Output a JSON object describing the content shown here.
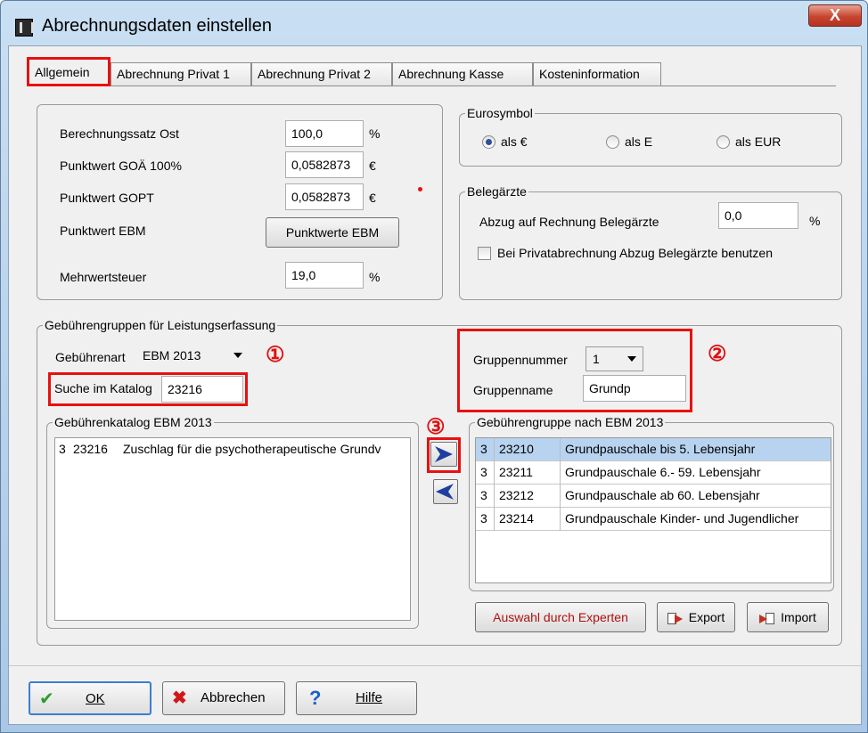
{
  "window": {
    "title": "Abrechnungsdaten einstellen",
    "close_label": "X"
  },
  "tabs": [
    "Allgemein",
    "Abrechnung Privat 1",
    "Abrechnung Privat 2",
    "Abrechnung Kasse",
    "Kosteninformation"
  ],
  "left_panel": {
    "berechnungssatz_label": "Berechnungssatz Ost",
    "berechnungssatz_value": "100,0",
    "berechnungssatz_unit": "%",
    "punktwert_goae_label": "Punktwert GOÄ 100%",
    "punktwert_goae_value": "0,0582873",
    "punktwert_goae_unit": "€",
    "punktwert_gopt_label": "Punktwert GOPT",
    "punktwert_gopt_value": "0,0582873",
    "punktwert_gopt_unit": "€",
    "punktwert_ebm_label": "Punktwert EBM",
    "punktwerte_ebm_button": "Punktwerte EBM",
    "mwst_label": "Mehrwertsteuer",
    "mwst_value": "19,0",
    "mwst_unit": "%"
  },
  "eurosymbol": {
    "legend": "Eurosymbol",
    "options": [
      "als €",
      "als E",
      "als EUR"
    ],
    "selected": "als €"
  },
  "belegaerzte": {
    "legend": "Belegärzte",
    "abzug_label": "Abzug auf Rechnung Belegärzte",
    "abzug_value": "0,0",
    "abzug_unit": "%",
    "checkbox_label": "Bei Privatabrechnung Abzug Belegärzte benutzen",
    "checkbox_checked": false
  },
  "gebuehrengruppen": {
    "legend": "Gebührengruppen für Leistungserfassung",
    "gebuehrenart_label": "Gebührenart",
    "gebuehrenart_value": "EBM 2013",
    "suche_label": "Suche im Katalog",
    "suche_value": "23216",
    "gruppennummer_label": "Gruppennummer",
    "gruppennummer_value": "1",
    "gruppenname_label": "Gruppenname",
    "gruppenname_value": "Grundp",
    "katalog_legend": "Gebührenkatalog EBM 2013",
    "katalog_rows": [
      {
        "col1": "3",
        "col2": "23216",
        "col3": "Zuschlag für die psychotherapeutische Grundv"
      }
    ],
    "gruppe_legend": "Gebührengruppe nach EBM 2013",
    "gruppe_rows": [
      {
        "col1": "3",
        "col2": "23210",
        "col3": "Grundpauschale bis 5. Lebensjahr"
      },
      {
        "col1": "3",
        "col2": "23211",
        "col3": "Grundpauschale 6.- 59. Lebensjahr"
      },
      {
        "col1": "3",
        "col2": "23212",
        "col3": "Grundpauschale ab 60. Lebensjahr"
      },
      {
        "col1": "3",
        "col2": "23214",
        "col3": "Grundpauschale Kinder- und Jugendlicher"
      }
    ],
    "experten_button": "Auswahl durch Experten",
    "export_button": "Export",
    "import_button": "Import"
  },
  "markers": [
    "①",
    "②",
    "③"
  ],
  "footer": {
    "ok": "OK",
    "abbrechen": "Abbrechen",
    "hilfe": "Hilfe"
  },
  "colors": {
    "highlight_red": "#e81010",
    "selection": "#b8d3f0",
    "arrow_blue": "#1e3fa0"
  }
}
